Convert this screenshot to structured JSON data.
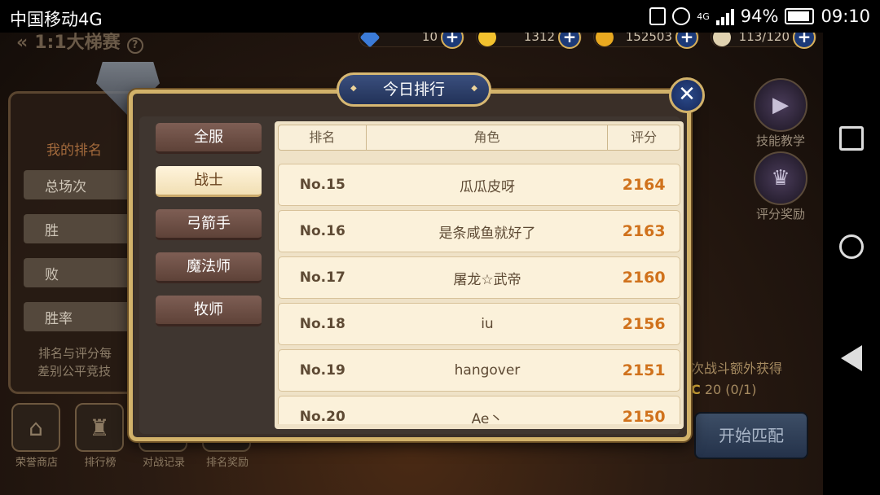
{
  "status_bar": {
    "carrier": "中国移动4G",
    "network": "4G",
    "battery": "94%",
    "time": "09:10"
  },
  "header": {
    "title": "1:1大梯赛",
    "help": "?"
  },
  "currencies": [
    {
      "icon": "diamond-icon",
      "value": "10",
      "plus": "+"
    },
    {
      "icon": "moon-coin-icon",
      "value": "1312",
      "plus": "+"
    },
    {
      "icon": "gold-coin-icon",
      "value": "152503",
      "plus": "+"
    },
    {
      "icon": "wing-icon",
      "value": "113/120",
      "plus": "+"
    }
  ],
  "left_panel": {
    "title": "我的排名",
    "rows": [
      "总场次",
      "胜",
      "败",
      "胜率"
    ],
    "note_line1": "排名与评分每",
    "note_line2": "无差别公平竞技"
  },
  "bottom_buttons": [
    {
      "label": "荣誉商店",
      "icon": "shop-icon"
    },
    {
      "label": "排行榜",
      "icon": "trophy-icon"
    },
    {
      "label": "对战记录",
      "icon": "record-icon"
    },
    {
      "label": "排名奖励",
      "icon": "reward-icon"
    }
  ],
  "right_side": {
    "skill_label": "技能教学",
    "reward_label": "评分奖励",
    "bonus_line1": "次战斗额外获得",
    "bonus_coin": "C",
    "bonus_line2": "20 (0/1)",
    "match_button": "开始匹配"
  },
  "modal": {
    "title": "今日排行",
    "close": "✕",
    "categories": [
      {
        "label": "全服",
        "active": false
      },
      {
        "label": "战士",
        "active": true
      },
      {
        "label": "弓箭手",
        "active": false
      },
      {
        "label": "魔法师",
        "active": false
      },
      {
        "label": "牧师",
        "active": false
      }
    ],
    "columns": [
      "排名",
      "角色",
      "评分"
    ],
    "rows": [
      {
        "rank": "No.15",
        "name": "瓜瓜皮呀",
        "score": "2164"
      },
      {
        "rank": "No.16",
        "name": "是条咸鱼就好了",
        "score": "2163"
      },
      {
        "rank": "No.17",
        "name": "屠龙☆武帝",
        "score": "2160"
      },
      {
        "rank": "No.18",
        "name": "iu",
        "score": "2156"
      },
      {
        "rank": "No.19",
        "name": "hangover",
        "score": "2151"
      },
      {
        "rank": "No.20",
        "name": "Ae丶",
        "score": "2150"
      }
    ]
  },
  "colors": {
    "gold_border": "#d2b26a",
    "score_orange": "#d0721c",
    "title_blue": "#223258"
  }
}
